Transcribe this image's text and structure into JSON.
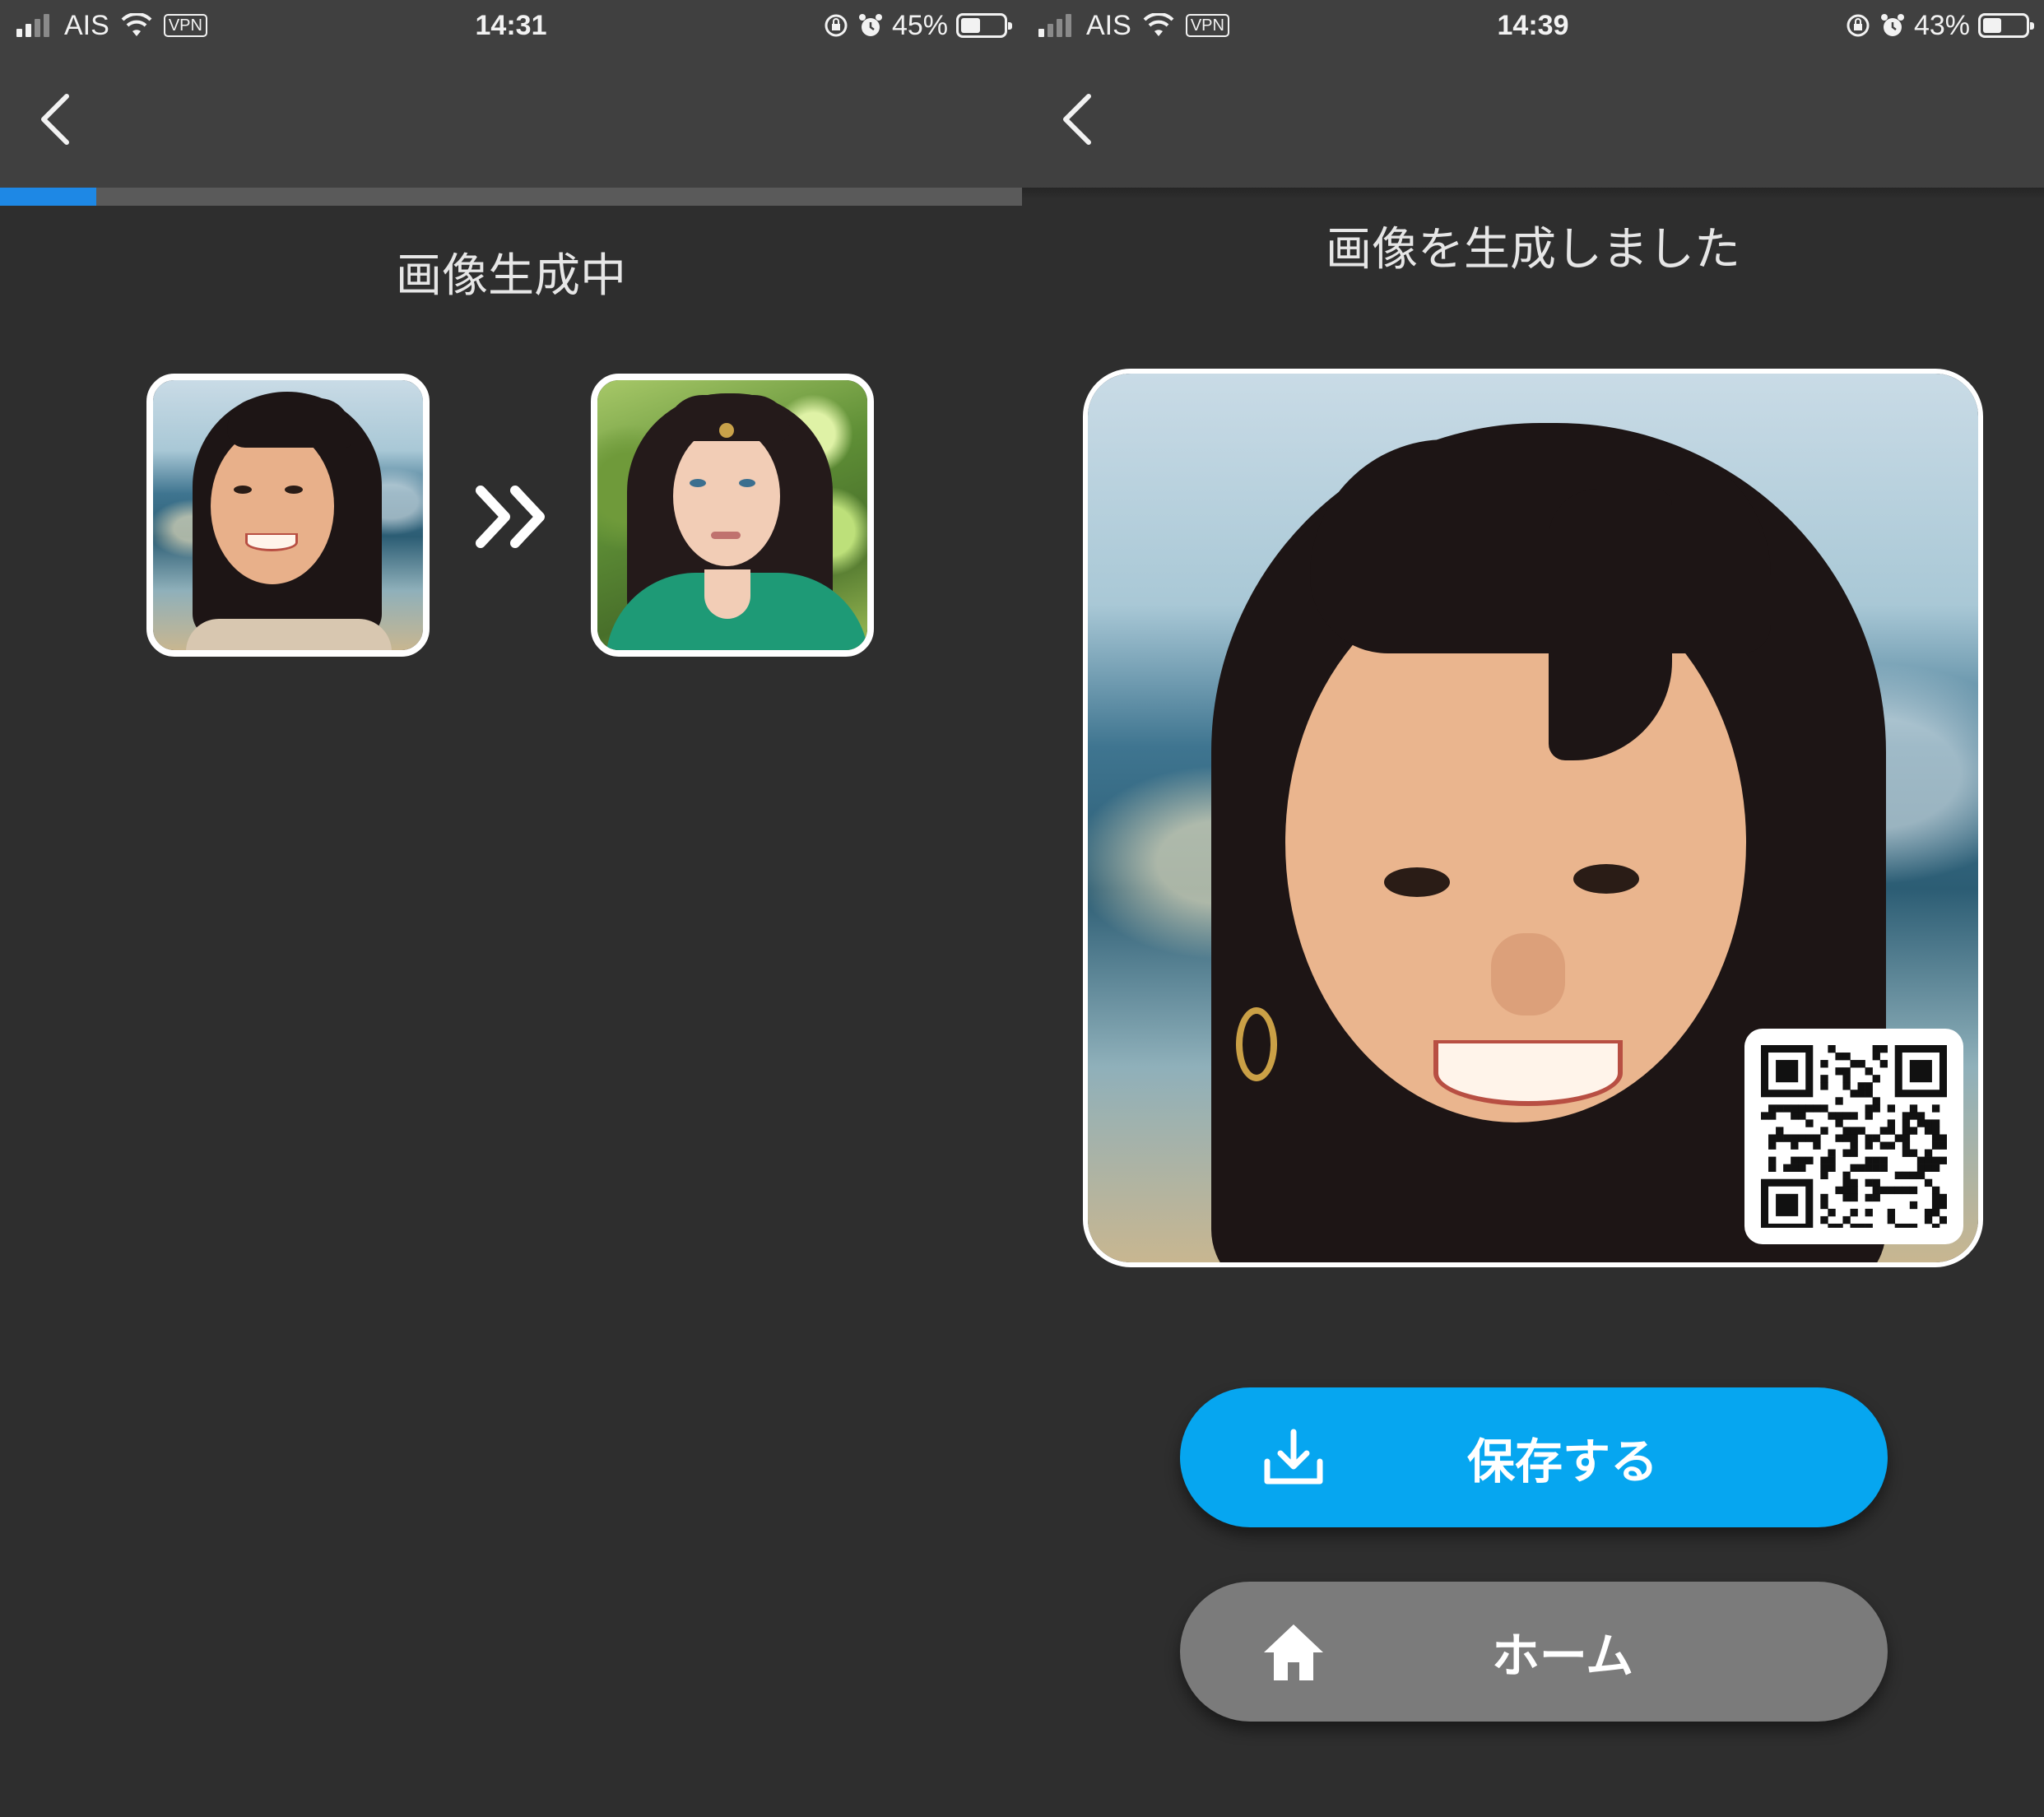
{
  "screens": [
    {
      "status": {
        "carrier": "AIS",
        "vpn": "VPN",
        "time": "14:31",
        "battery": "45%",
        "battery_level": 0.45,
        "signal_bars_on": 2
      },
      "title": "画像生成中",
      "progress": 0.094,
      "source_image": "portrait-photo",
      "output_image": "portrait-illustration"
    },
    {
      "status": {
        "carrier": "AIS",
        "vpn": "VPN",
        "time": "14:39",
        "battery": "43%",
        "battery_level": 0.43,
        "signal_bars_on": 1
      },
      "title": "画像を生成しました",
      "result_image": "portrait-photo-with-qr",
      "buttons": {
        "save_label": "保存する",
        "save_icon": "download-icon",
        "home_label": "ホーム",
        "home_icon": "home-icon"
      }
    }
  ],
  "colors": {
    "background": "#2e2e2e",
    "bar": "#404040",
    "progress": "#1e88e5",
    "save_button": "#06a6f0",
    "home_button": "#7b7b7b"
  }
}
